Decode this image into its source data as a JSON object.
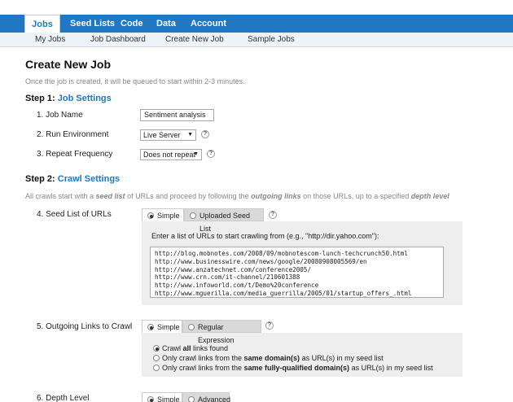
{
  "topnav": {
    "tabs": [
      {
        "label": "Jobs"
      },
      {
        "label": "Seed Lists"
      },
      {
        "label": "Code"
      },
      {
        "label": "Data"
      },
      {
        "label": "Account"
      }
    ]
  },
  "subnav": {
    "items": [
      {
        "label": "My Jobs"
      },
      {
        "label": "Job Dashboard"
      },
      {
        "label": "Create New Job"
      },
      {
        "label": "Sample Jobs"
      }
    ]
  },
  "page": {
    "title": "Create New Job",
    "intro": "Once the job is created, it will be queued to start within 2-3 minutes."
  },
  "step1": {
    "prefix": "Step 1:",
    "title": "Job Settings",
    "job_name_label": "1. Job Name",
    "job_name_value": "Sentiment analysis",
    "run_env_label": "2. Run Environment",
    "run_env_value": "Live Server",
    "repeat_label": "3. Repeat Frequency",
    "repeat_value": "Does not repeat"
  },
  "step2": {
    "prefix": "Step 2:",
    "title": "Crawl Settings",
    "desc_1": "All crawls start with a ",
    "desc_2": "seed list",
    "desc_3": " of URLs and proceed by following the ",
    "desc_4": "outgoing links",
    "desc_5": " on those URLs, up to a specified ",
    "desc_6": "depth level",
    "seed_label": "4. Seed List of URLs",
    "seed_tab_simple": "Simple",
    "seed_tab_uploaded": "Uploaded Seed List",
    "seed_instruction": "Enter a list of URLs to start crawling from (e.g., \"http://dir.yahoo.com\"):",
    "seed_urls": [
      "http://blog.mobnotes.com/2008/09/mobnotescom-lunch-techcrunch50.html",
      "http://www.businesswire.com/news/google/20080908005569/en",
      "http://www.anzatechnet.com/conference2005/",
      "http://www.crn.com/it-channel/210601388",
      "http://www.infoworld.com/t/Demo%20conference",
      "http://www.mguerilla.com/media_guerrilla/2005/01/startup_offers_.html"
    ],
    "links_label": "5. Outgoing Links to Crawl",
    "links_tab_simple": "Simple",
    "links_tab_regex": "Regular Expression",
    "choice1_a": "Crawl ",
    "choice1_b": "all",
    "choice1_c": " links found",
    "choice2_a": "Only crawl links from the ",
    "choice2_b": "same domain(s)",
    "choice2_c": " as URL(s) in my seed list",
    "choice3_a": "Only crawl links from the ",
    "choice3_b": "same fully-qualified domain(s)",
    "choice3_c": " as URL(s) in my seed list",
    "depth_label": "6. Depth Level",
    "depth_tab_simple": "Simple",
    "depth_tab_advanced": "Advanced"
  }
}
